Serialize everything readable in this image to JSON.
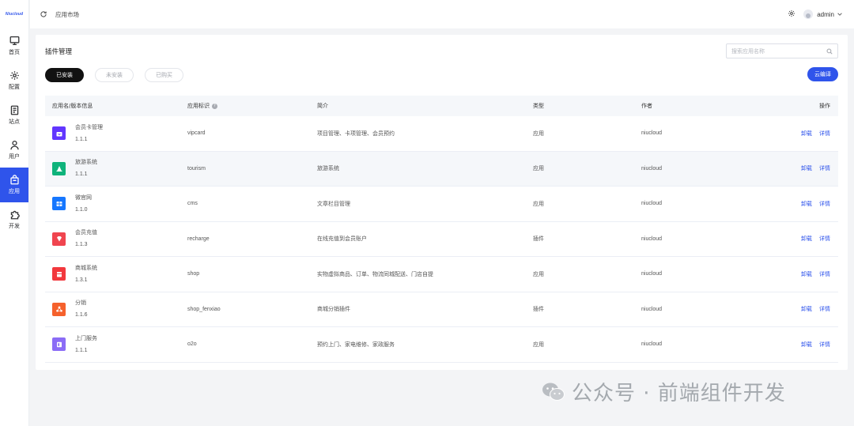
{
  "sidebar": {
    "logo_text": "Niucloud",
    "items": [
      {
        "label": "首页",
        "icon": "monitor-icon",
        "active": false
      },
      {
        "label": "配置",
        "icon": "gear-icon",
        "active": false
      },
      {
        "label": "站点",
        "icon": "document-icon",
        "active": false
      },
      {
        "label": "用户",
        "icon": "user-icon",
        "active": false
      },
      {
        "label": "应用",
        "icon": "shopping-bag-icon",
        "active": true
      },
      {
        "label": "开发",
        "icon": "puzzle-icon",
        "active": false
      }
    ]
  },
  "header": {
    "breadcrumb": "应用市场",
    "username": "admin"
  },
  "card": {
    "title": "插件管理",
    "search_placeholder": "搜索应用名称",
    "tabs": [
      {
        "label": "已安装",
        "active": true
      },
      {
        "label": "未安装",
        "active": false
      },
      {
        "label": "已购买",
        "active": false
      }
    ],
    "cloud_button": "云编译"
  },
  "table": {
    "columns": [
      "应用名/版本信息",
      "应用标识",
      "简介",
      "类型",
      "作者",
      "操作"
    ],
    "rows": [
      {
        "name": "会员卡管理",
        "version": "1.1.1",
        "key": "vipcard",
        "desc": "项目管理、卡项管理、会员预约",
        "type": "应用",
        "author": "niucloud",
        "icon": "gift-card-icon",
        "color": "#6236ff"
      },
      {
        "name": "旅游系统",
        "version": "1.1.1",
        "key": "tourism",
        "desc": "旅游系统",
        "type": "应用",
        "author": "niucloud",
        "icon": "travel-icon",
        "color": "#0fb37b"
      },
      {
        "name": "微官网",
        "version": "1.1.0",
        "key": "cms",
        "desc": "文章栏目管理",
        "type": "应用",
        "author": "niucloud",
        "icon": "website-icon",
        "color": "#1677ff"
      },
      {
        "name": "会员充值",
        "version": "1.1.3",
        "key": "recharge",
        "desc": "在线充值到会员账户",
        "type": "插件",
        "author": "niucloud",
        "icon": "diamond-icon",
        "color": "#f0454f"
      },
      {
        "name": "商城系统",
        "version": "1.3.1",
        "key": "shop",
        "desc": "实物虚拟商品、订单、物流同城配送、门店自提",
        "type": "应用",
        "author": "niucloud",
        "icon": "store-icon",
        "color": "#f2383d"
      },
      {
        "name": "分销",
        "version": "1.1.6",
        "key": "shop_fenxiao",
        "desc": "商城分销插件",
        "type": "插件",
        "author": "niucloud",
        "icon": "distribution-icon",
        "color": "#f5612c"
      },
      {
        "name": "上门服务",
        "version": "1.1.1",
        "key": "o2o",
        "desc": "预约上门、家电维修、家政服务",
        "type": "应用",
        "author": "niucloud",
        "icon": "service-icon",
        "color": "#8b6cf6"
      }
    ],
    "action_uninstall": "卸载",
    "action_detail": "详情"
  },
  "watermark": "公众号 · 前端组件开发"
}
